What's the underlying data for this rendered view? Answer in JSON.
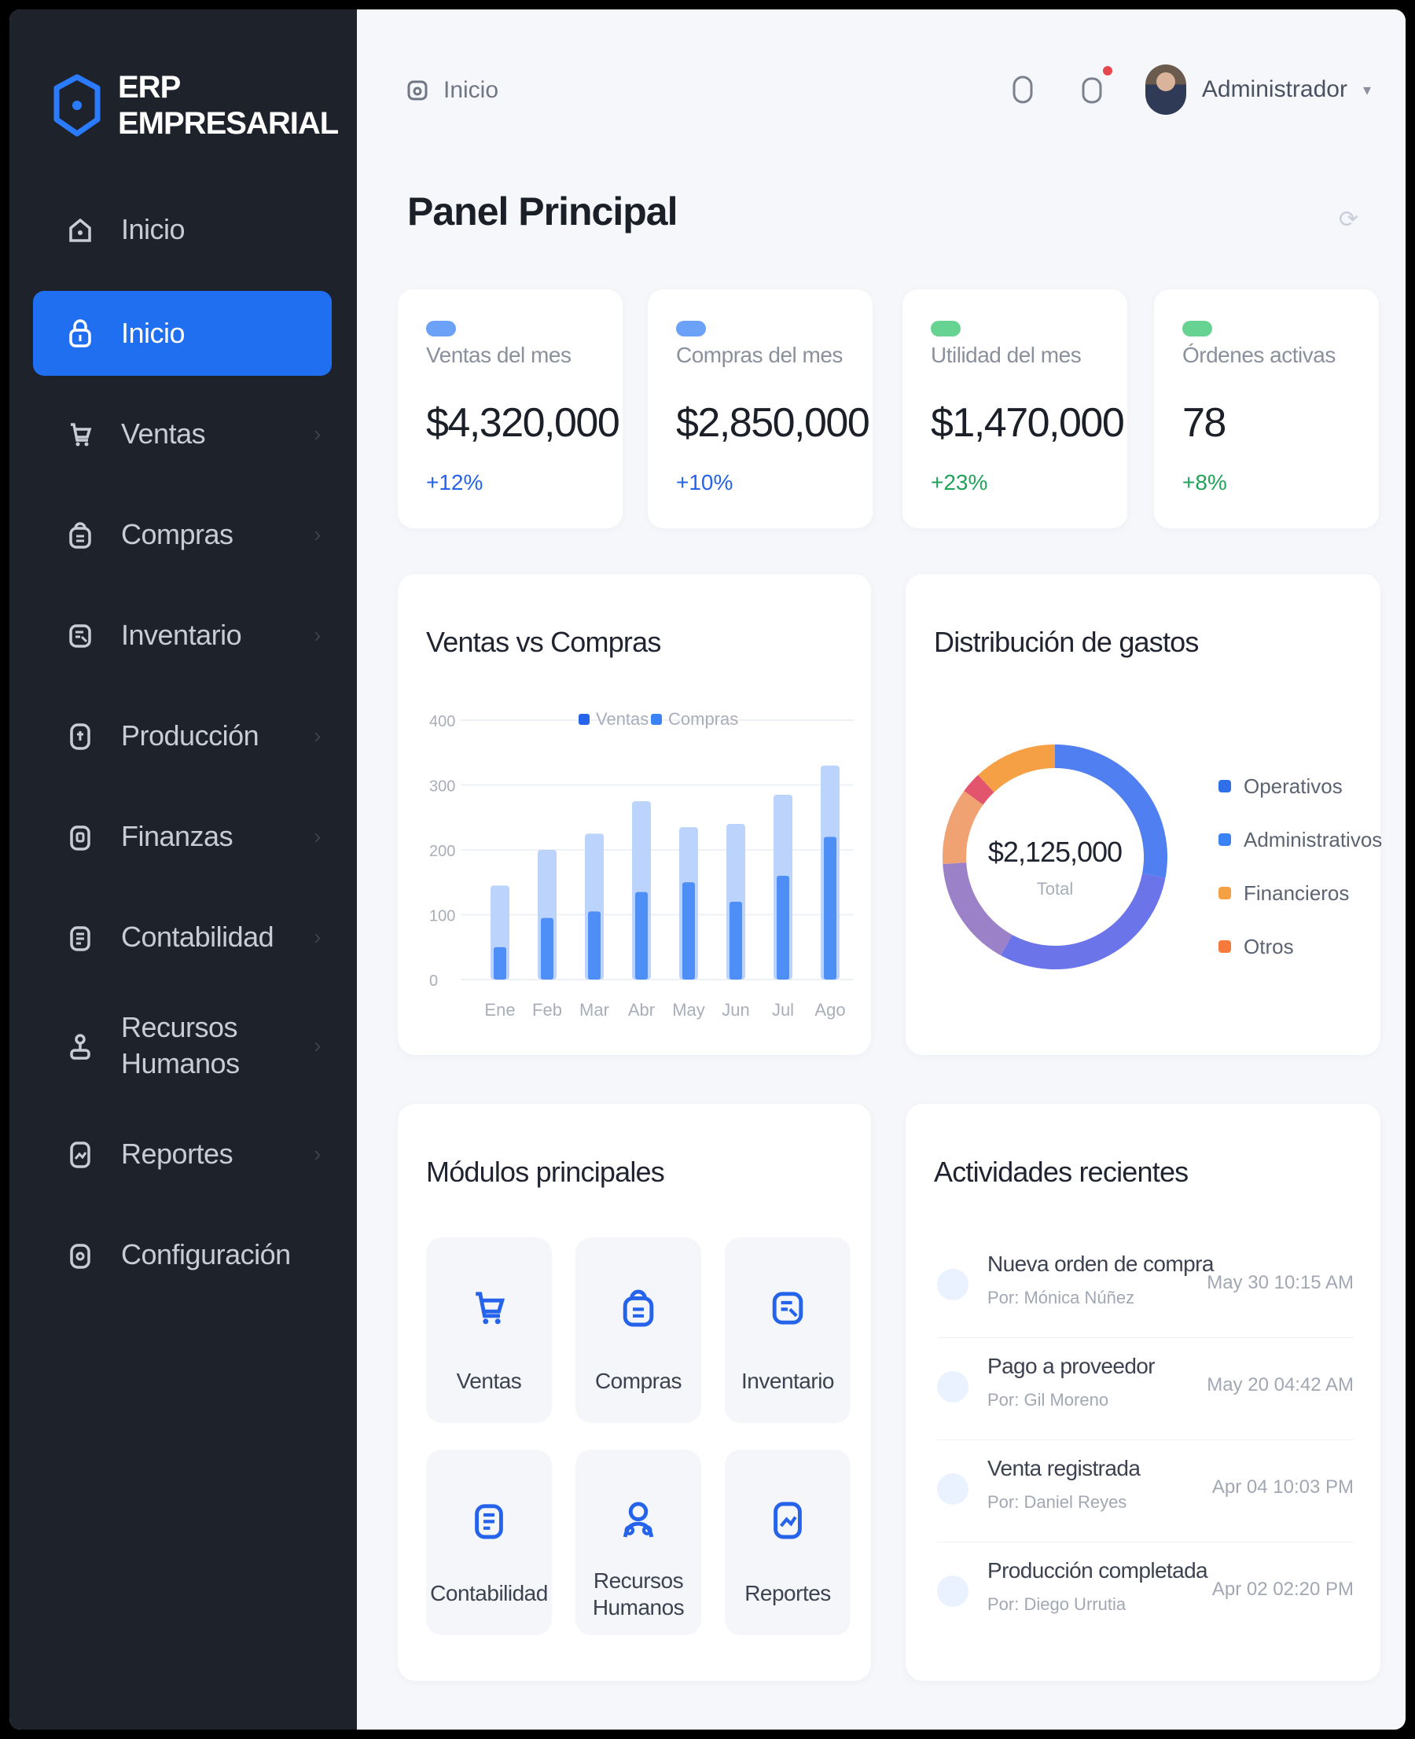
{
  "brand": {
    "line1": "ERP",
    "line2": "EMPRESARIAL"
  },
  "sidebar": {
    "items": [
      {
        "label": "Inicio",
        "icon": "home-icon",
        "active": false
      },
      {
        "label": "Inicio",
        "icon": "lock-icon",
        "active": true
      },
      {
        "label": "Ventas",
        "icon": "cart-icon",
        "active": false
      },
      {
        "label": "Compras",
        "icon": "bag-icon",
        "active": false
      },
      {
        "label": "Inventario",
        "icon": "box-icon",
        "active": false
      },
      {
        "label": "Producción",
        "icon": "factory-icon",
        "active": false
      },
      {
        "label": "Finanzas",
        "icon": "wallet-icon",
        "active": false
      },
      {
        "label": "Contabilidad",
        "icon": "ledger-icon",
        "active": false
      },
      {
        "label": "Recursos Humanos",
        "icon": "user-icon",
        "active": false
      },
      {
        "label": "Reportes",
        "icon": "report-icon",
        "active": false
      },
      {
        "label": "Configuración",
        "icon": "settings-icon",
        "active": false
      }
    ]
  },
  "topbar": {
    "breadcrumb": "Inicio",
    "user_name": "Administrador"
  },
  "page": {
    "title": "Panel Principal"
  },
  "kpis": [
    {
      "label": "Ventas del mes",
      "value": "$4,320,000",
      "trend": "+12%",
      "color": "#2563eb",
      "icon_color": "#3b82f6"
    },
    {
      "label": "Compras del mes",
      "value": "$2,850,000",
      "trend": "+10%",
      "color": "#2563eb",
      "icon_color": "#3b82f6"
    },
    {
      "label": "Utilidad del mes",
      "value": "$1,470,000",
      "trend": "+23%",
      "color": "#22a35a",
      "icon_color": "#34c46f"
    },
    {
      "label": "Órdenes activas",
      "value": "78",
      "trend": "+8%",
      "color": "#22a35a",
      "icon_color": "#34c46f"
    }
  ],
  "sales_chart": {
    "title": "Ventas vs Compras",
    "legend": [
      "Ventas",
      "Compras"
    ]
  },
  "chart_data": {
    "type": "bar",
    "categories": [
      "Ene",
      "Feb",
      "Mar",
      "Abr",
      "May",
      "Jun",
      "Jul",
      "Ago"
    ],
    "series": [
      {
        "name": "Ventas",
        "values": [
          145,
          200,
          225,
          275,
          235,
          240,
          285,
          330
        ]
      },
      {
        "name": "Compras",
        "values": [
          50,
          95,
          105,
          135,
          150,
          120,
          160,
          220
        ]
      }
    ],
    "ytick_labels": [
      "0",
      "100",
      "200",
      "300",
      "400"
    ],
    "ylim": [
      0,
      400
    ],
    "colors": {
      "Ventas": "#bcd3fb",
      "Compras": "#3b82f6"
    }
  },
  "expenses_chart": {
    "title": "Distribución de gastos",
    "total": "$2,125,000",
    "total_label": "Total",
    "legend": [
      "Operativos",
      "Administrativos",
      "Financieros",
      "Otros"
    ],
    "legend_colors": [
      "#2f6fea",
      "#3b82f6",
      "#f5a045",
      "#f57a3c"
    ]
  },
  "expenses_data": {
    "type": "pie",
    "segments": [
      {
        "color": "#4f7ff0",
        "value": 28
      },
      {
        "color": "#6b74e8",
        "value": 30
      },
      {
        "color": "#9b82c8",
        "value": 16
      },
      {
        "color": "#f0a273",
        "value": 11
      },
      {
        "color": "#e2556d",
        "value": 3
      },
      {
        "color": "#f5a045",
        "value": 12
      }
    ]
  },
  "modules": {
    "title": "Módulos principales",
    "items": [
      {
        "label": "Ventas",
        "icon": "cart-icon"
      },
      {
        "label": "Compras",
        "icon": "bag-icon"
      },
      {
        "label": "Inventario",
        "icon": "box-icon"
      },
      {
        "label": "Contabilidad",
        "icon": "ledger-icon"
      },
      {
        "label": "Recursos Humanos",
        "icon": "team-icon"
      },
      {
        "label": "Reportes",
        "icon": "report-icon"
      }
    ]
  },
  "activities": {
    "title": "Actividades recientes",
    "items": [
      {
        "title": "Nueva orden de compra",
        "subtitle": "Por: Mónica Núñez",
        "time": "May 30 10:15 AM"
      },
      {
        "title": "Pago a proveedor",
        "subtitle": "Por: Gil Moreno",
        "time": "May 20 04:42 AM"
      },
      {
        "title": "Venta registrada",
        "subtitle": "Por: Daniel Reyes",
        "time": "Apr 04 10:03 PM"
      },
      {
        "title": "Producción completada",
        "subtitle": "Por: Diego Urrutia",
        "time": "Apr 02 02:20 PM"
      }
    ]
  }
}
